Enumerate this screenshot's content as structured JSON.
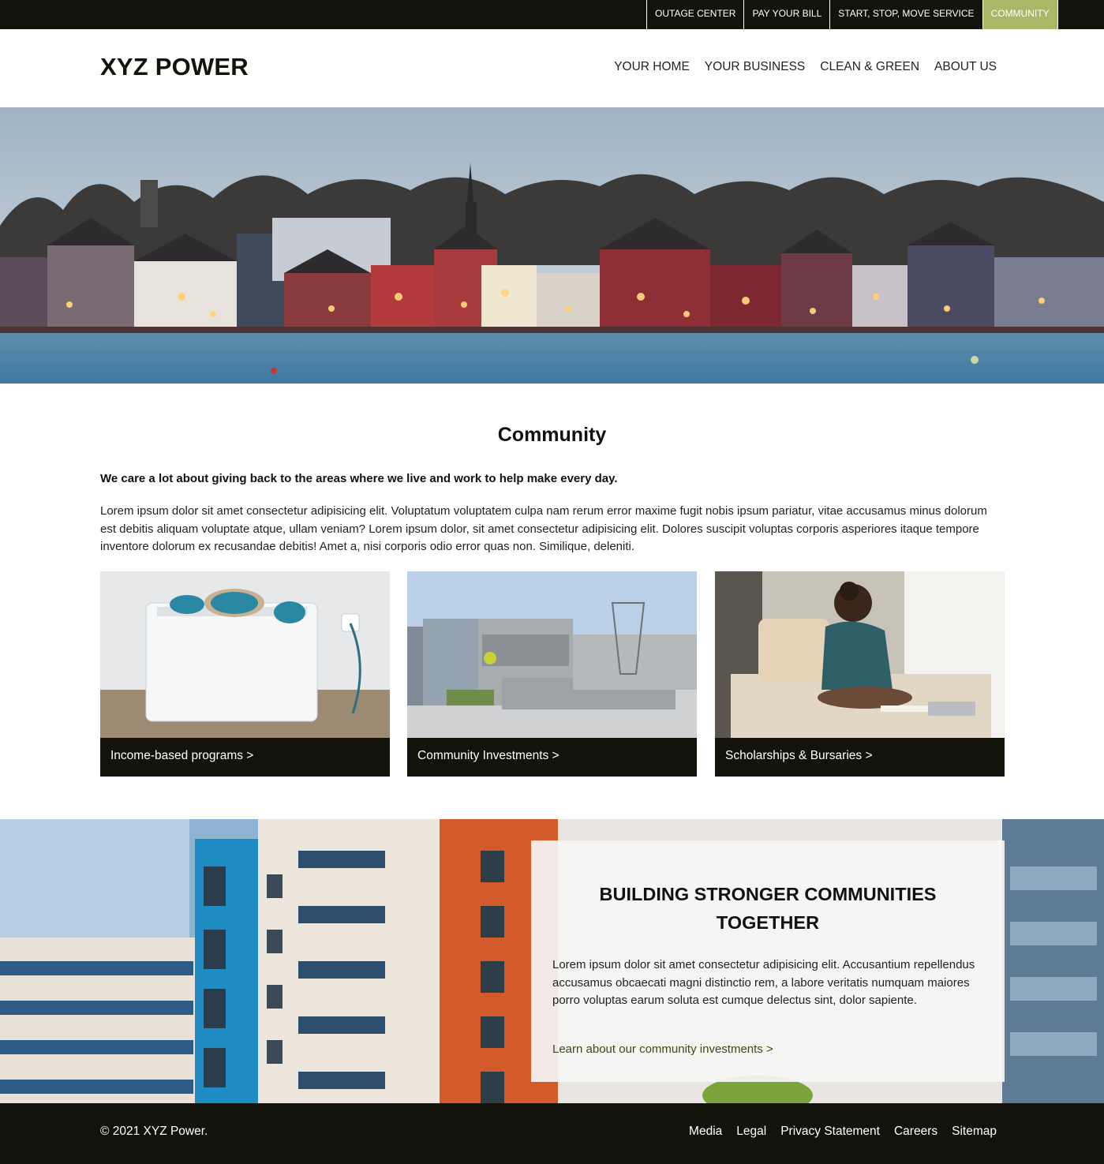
{
  "utility_nav": [
    {
      "label": "OUTAGE CENTER",
      "active": false
    },
    {
      "label": "PAY YOUR BILL",
      "active": false
    },
    {
      "label": "START, STOP, MOVE SERVICE",
      "active": false
    },
    {
      "label": "COMMUNITY",
      "active": true
    }
  ],
  "header": {
    "logo": "XYZ POWER",
    "nav": [
      "YOUR HOME",
      "YOUR BUSINESS",
      "CLEAN & GREEN",
      "ABOUT US"
    ]
  },
  "colors": {
    "dark": "#13130c",
    "accent": "#a8b867",
    "link": "#3a4a10"
  },
  "main": {
    "title": "Community",
    "lead": "We care a lot about giving back to the areas where we live and work to help make every day.",
    "body": "Lorem ipsum dolor sit amet consectetur adipisicing elit. Voluptatum voluptatem culpa nam rerum error maxime fugit nobis ipsum pariatur, vitae accusamus minus dolorum est debitis aliquam voluptate atque, ullam veniam? Lorem ipsum dolor, sit amet consectetur adipisicing elit. Dolores suscipit voluptas corporis asperiores itaque tempore inventore dolorum ex recusandae debitis! Amet a, nisi corporis odio error quas non. Similique, deleniti."
  },
  "cards": [
    {
      "label": "Income-based programs >"
    },
    {
      "label": "Community Investments >"
    },
    {
      "label": "Scholarships & Bursaries >"
    }
  ],
  "feature": {
    "title": "BUILDING STRONGER COMMUNITIES TOGETHER",
    "text": "Lorem ipsum dolor sit amet consectetur adipisicing elit. Accusantium repellendus accusamus obcaecati magni distinctio rem, a labore veritatis numquam maiores porro voluptas earum soluta est cumque delectus sint, dolor sapiente.",
    "link": "Learn about our community investments >"
  },
  "footer": {
    "copyright": "© 2021 XYZ Power.",
    "links": [
      "Media",
      "Legal",
      "Privacy Statement",
      "Careers",
      "Sitemap"
    ]
  }
}
